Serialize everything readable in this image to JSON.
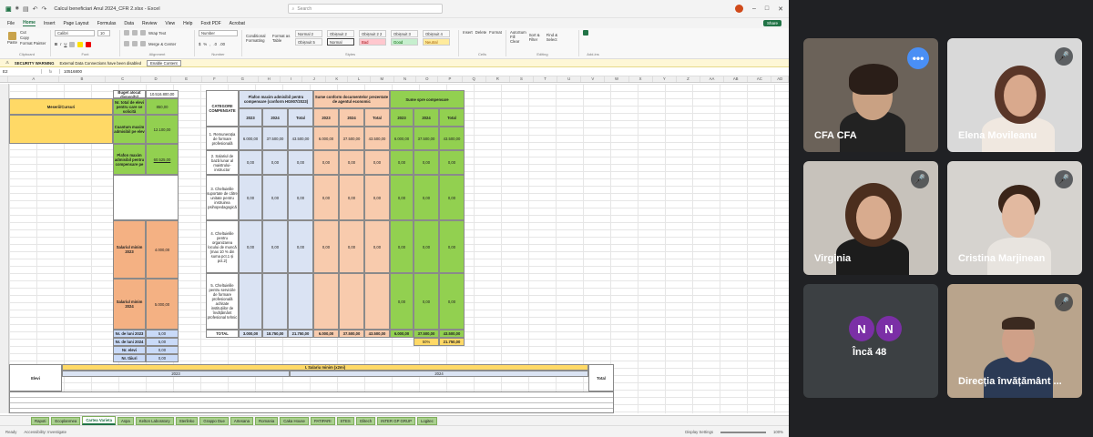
{
  "excel": {
    "title": "Calcul beneficiari Anul 2024_CFR 2.xlsx  -  Excel",
    "search_placeholder": "Search",
    "menus": [
      "File",
      "Home",
      "Insert",
      "Page Layout",
      "Formulas",
      "Data",
      "Review",
      "View",
      "Help",
      "Foxit PDF",
      "Acrobat"
    ],
    "active_menu": "Home",
    "share_label": "Share",
    "ribbon": {
      "clipboard": {
        "paste": "Paste",
        "cut": "Cut",
        "copy": "Copy",
        "format_painter": "Format Painter",
        "label": "Clipboard"
      },
      "font": {
        "name": "Calibri",
        "size": "10",
        "label": "Font"
      },
      "alignment": {
        "wrap": "Wrap Text",
        "merge": "Merge & Center",
        "label": "Alignment"
      },
      "number": {
        "format": "Number",
        "label": "Number"
      },
      "styles": {
        "cond": "Conditional Formatting",
        "table": "Format as Table",
        "items": [
          "Normal 2",
          "Obișnuit 2",
          "Obișnuit 2 2",
          "Obișnuit 3",
          "Obișnuit 4",
          "Obișnuit 5",
          "Normal",
          "Bad",
          "Good",
          "Neutral"
        ],
        "label": "Styles"
      },
      "cells": {
        "insert": "Insert",
        "delete": "Delete",
        "format": "Format",
        "label": "Cells"
      },
      "editing": {
        "autosum": "AutoSum",
        "fill": "Fill",
        "clear": "Clear",
        "sort": "Sort & Filter",
        "find": "Find & Select",
        "label": "Editing"
      },
      "addins": {
        "label": "Add-ins"
      }
    },
    "security": {
      "warning": "SECURITY WARNING",
      "message": "External Data Connections have been disabled",
      "button": "Enable Content"
    },
    "formula": {
      "cell": "E2",
      "value": "10516800"
    },
    "columns": [
      "A",
      "B",
      "C",
      "D",
      "E",
      "F",
      "G",
      "H",
      "I",
      "J",
      "K",
      "L",
      "M",
      "N",
      "O",
      "P",
      "Q",
      "R",
      "S",
      "T",
      "U",
      "V",
      "W",
      "X",
      "Y",
      "Z",
      "AA",
      "AB",
      "AC",
      "AD"
    ],
    "cells": {
      "buget": "Buget alocat disponibil",
      "buget_val": "10.516.800,00",
      "nr_total": "Nr. total de elevi pentru care se solicită",
      "nr_total_val": "850,00",
      "meserii": "Meserii/Cursuri",
      "cuantum": "Cuantum maxim admisibil pe elev",
      "cuantum_val": "12.100,00",
      "plafon": "Plafon maxim admisibil pentru compensare pe",
      "plafon_val": "60.525,00",
      "salariul2023": "Salariul minim 2023",
      "salariul2023_val": "4.000,00",
      "salariul2024": "Salariul minim 2024",
      "salariul2024_val": "5.000,00",
      "nr_luni_2023": "Nr. de luni 2023",
      "nr_luni_2024": "Nr. de luni 2024",
      "nr_elevi": "Nr. elevi",
      "nr_elevi2": "Nr. tăiuri",
      "categorii": "CATEGORII COMPENSATE",
      "plafon_head": "Plafon maxim admisibil pentru compensare (conform HG907/2023)",
      "sume_head": "Sume conform documentelor prezentate de agentul economic",
      "sume_comp": "Sume spre compensare",
      "y2023": "2023",
      "y2024": "2024",
      "total": "Total",
      "row1": "1. Remunerația de formare profesională",
      "row2": "2. Salariul de bază lunar al maistrului-instructor",
      "row3": "3. Cheltuielile suportate de către unitate pentru instruirea psihopedagogică",
      "row4": "4. Cheltuielile pentru organizarea locului de muncă (max 10 % din suma pct.1 și pct.2)",
      "row5": "5. Cheltuielile pentru serviciile de formare profesională achitate instituțiilor de învățământ profesional tehnic",
      "v_6000": "6.000,00",
      "v_37500": "37.500,00",
      "v_43500": "43.500,00",
      "v_zero": "0,00",
      "totalul": "TOTAL",
      "v_3000": "3.000,00",
      "v_18750": "18.750,00",
      "v_21750": "21.750,00",
      "pct": "50%",
      "salariu_sect": "I. Salariu minim (x2mi)",
      "elevi": "Elevi",
      "nr_luni_val": "5,00",
      "nr_luni2_val": "5,00",
      "nr_elevi_val": "0,00",
      "nr_elevi2_val": "0,00"
    },
    "sheet_tabs": [
      "Rapoti",
      "Ecoplanmea",
      "Cartea Varieta",
      "Aspa",
      "Kelton Laboratory",
      "Sterlinko",
      "Grappo Due",
      "Artesana",
      "Romania",
      "Caka House",
      "PATIPARI",
      "STES",
      "Glitech",
      "INTER GP GRUP",
      "Logitec"
    ],
    "active_tab": "Cartea Varieta",
    "status": {
      "ready": "Ready",
      "access": "Accessibility: Investigate",
      "display": "Display Settings",
      "zoom": "100%"
    }
  },
  "participants": [
    {
      "name": "CFA CFA",
      "more": "..."
    },
    {
      "name": "Elena Movileanu"
    },
    {
      "name": "Virginia"
    },
    {
      "name": "Cristina Marjinean"
    },
    {
      "name": "Încă 48",
      "initials": [
        "N",
        "N"
      ]
    },
    {
      "name": "Direcția învățământ ..."
    }
  ]
}
